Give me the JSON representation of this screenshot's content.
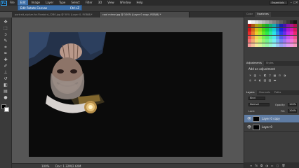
{
  "menubar": {
    "logo": "Ps",
    "items": [
      "File",
      "Edit",
      "Image",
      "Layer",
      "Type",
      "Select",
      "Filter",
      "3D",
      "View",
      "Window",
      "Help"
    ],
    "active_index": 1,
    "workspace": "Essentials"
  },
  "dropdown": {
    "label": "Edit Rotate Canvas",
    "shortcut": "Ctrl+Z"
  },
  "tabs": [
    {
      "label": "portrait_stylize-for-Flowbird_1280.jpg @ 50% (Layer 0, RGB/8)*",
      "active": false
    },
    {
      "label": "cool mirror.jpg @ 100% (Layer 0 copy, RGB/8) *",
      "active": true
    }
  ],
  "status": {
    "zoom": "100%",
    "doc": "Doc: 1.32M/2.64M"
  },
  "panels": {
    "top_tabs": [
      "Color",
      "Swatches"
    ],
    "adjustments_tabs": [
      "Adjustments",
      "Styles"
    ],
    "add_adjustment": "Add an adjustment",
    "layers_tabs": [
      "Layers",
      "Channels",
      "Paths"
    ],
    "kind": "Kind",
    "blend_mode": "Normal",
    "opacity_label": "Opacity:",
    "opacity": "100%",
    "lock_label": "Lock:",
    "fill_label": "Fill:",
    "fill": "100%",
    "layers": [
      {
        "name": "Layer 0 copy",
        "selected": true
      },
      {
        "name": "Layer 0",
        "selected": false
      }
    ]
  },
  "colors": {
    "menu_highlight": "#3d6fa8",
    "canvas_bg": "#0b0b0b",
    "selected_layer": "#5f7ca3"
  }
}
